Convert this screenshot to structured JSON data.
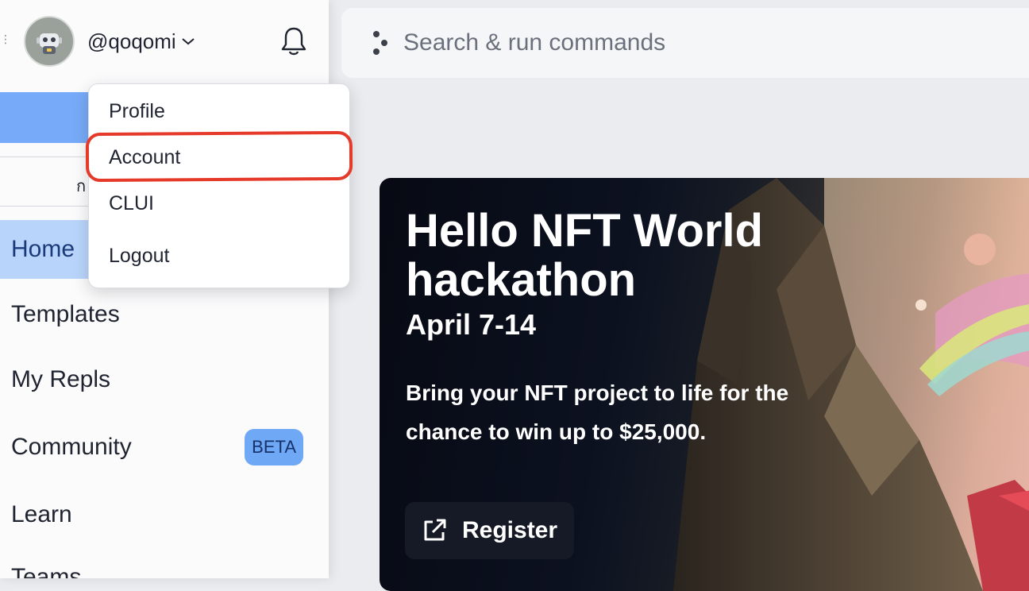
{
  "sidebar": {
    "username": "@qoqomi",
    "search_stub": "ก",
    "nav": [
      {
        "label": "Home"
      },
      {
        "label": "Templates"
      },
      {
        "label": "My Repls"
      },
      {
        "label": "Community",
        "badge": "BETA"
      },
      {
        "label": "Learn"
      },
      {
        "label": "Teams"
      }
    ]
  },
  "user_menu": {
    "items": [
      {
        "label": "Profile"
      },
      {
        "label": "Account"
      },
      {
        "label": "CLUI"
      },
      {
        "label": "Logout"
      }
    ],
    "highlighted": "Account"
  },
  "command_search": {
    "placeholder": "Search & run commands"
  },
  "hero": {
    "title": "Hello NFT World hackathon",
    "date": "April 7-14",
    "description": "Bring your NFT project to life for the chance to win up to $25,000.",
    "cta_label": "Register"
  },
  "colors": {
    "accent": "#77aaf8",
    "active_nav": "#b9d4fb",
    "beta_badge": "#6fa8f5",
    "highlight_ring": "#e5392a",
    "hero_dark": "#070a13"
  }
}
